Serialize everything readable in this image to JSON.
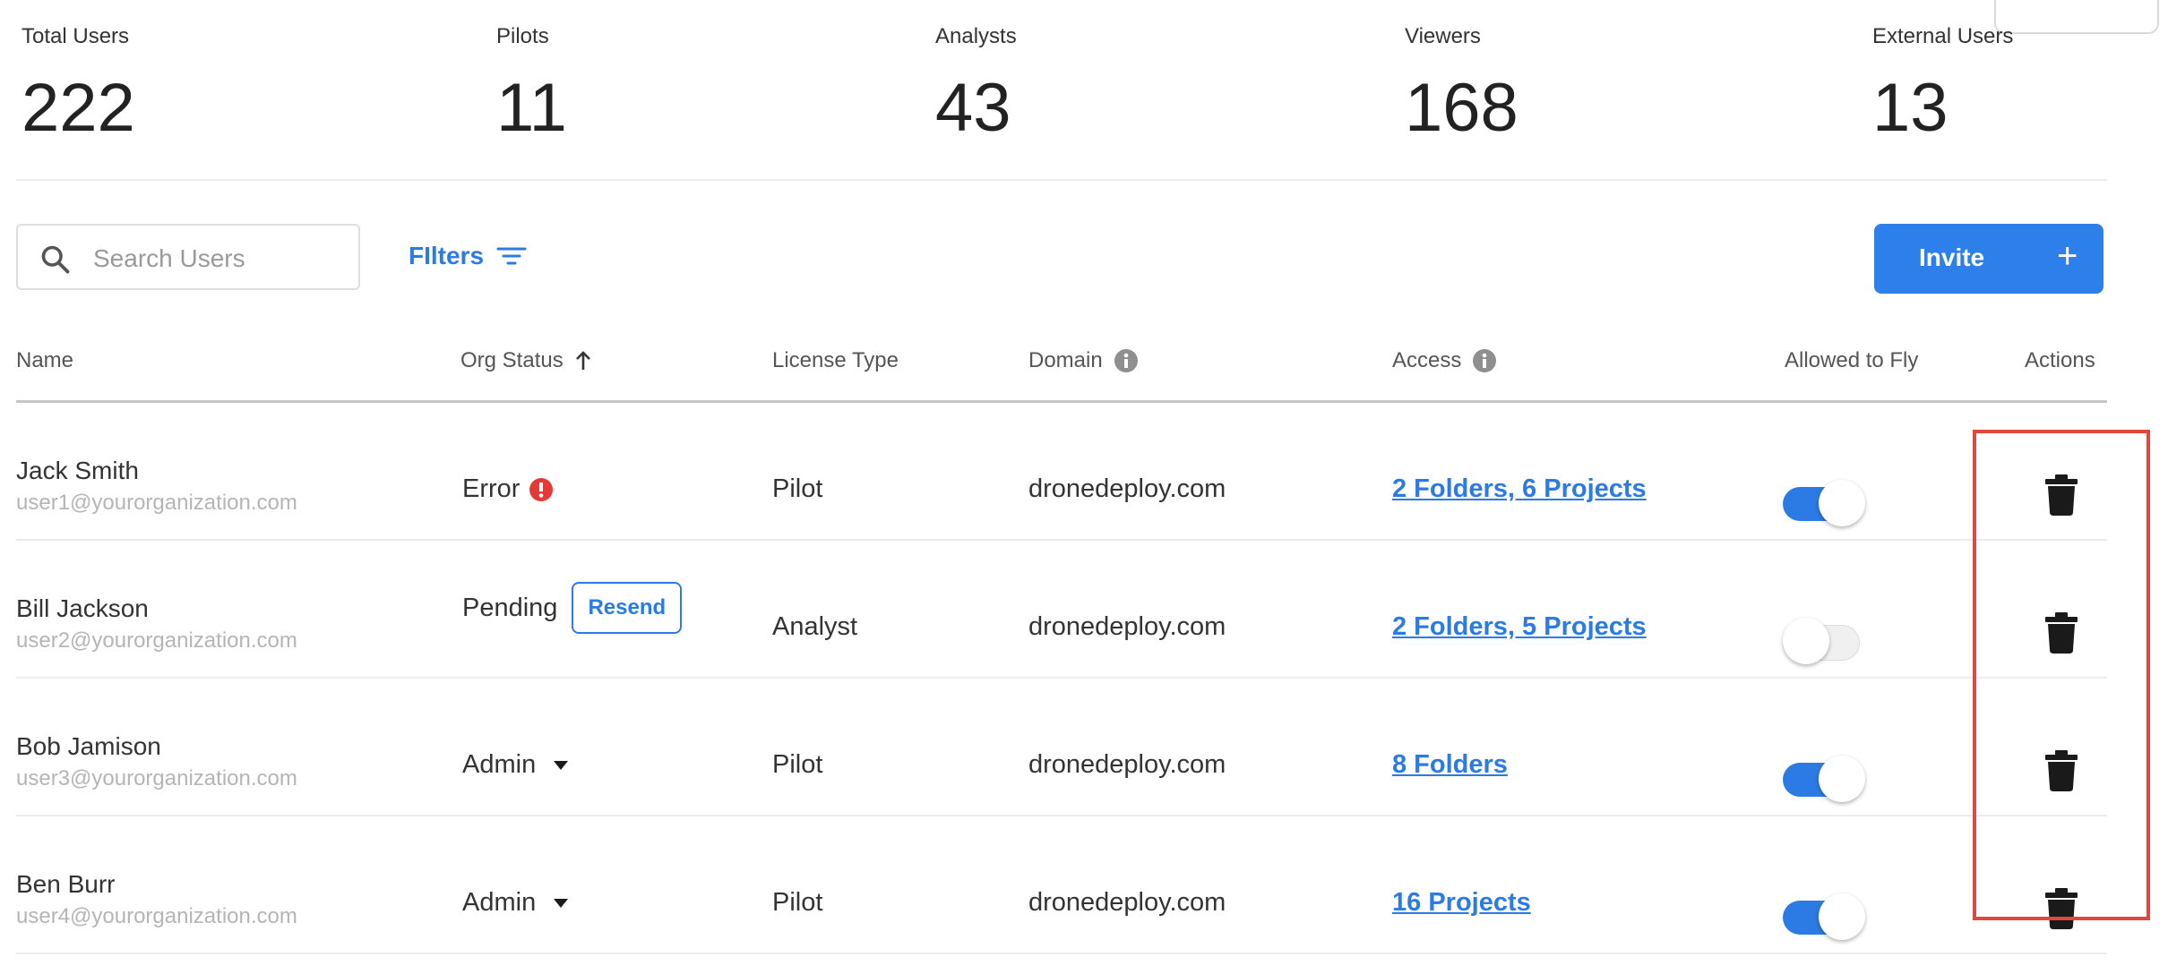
{
  "stats": [
    {
      "label": "Total Users",
      "value": "222"
    },
    {
      "label": "Pilots",
      "value": "11"
    },
    {
      "label": "Analysts",
      "value": "43"
    },
    {
      "label": "Viewers",
      "value": "168"
    },
    {
      "label": "External Users",
      "value": "13"
    }
  ],
  "toolbar": {
    "search_placeholder": "Search Users",
    "filters_label": "FIlters",
    "invite_label": "Invite",
    "invite_plus": "+"
  },
  "table": {
    "headers": {
      "name": "Name",
      "org_status": "Org Status",
      "license_type": "License Type",
      "domain": "Domain",
      "access": "Access",
      "allowed_to_fly": "Allowed to Fly",
      "actions": "Actions"
    },
    "rows": [
      {
        "name": "Jack Smith",
        "email": "user1@yourorganization.com",
        "status": "Error",
        "license": "Pilot",
        "domain": "dronedeploy.com",
        "access": "2 Folders, 6 Projects",
        "allowed_to_fly": true
      },
      {
        "name": "Bill Jackson",
        "email": "user2@yourorganization.com",
        "status": "Pending",
        "action_label": "Resend",
        "license": "Analyst",
        "domain": "dronedeploy.com",
        "access": "2 Folders, 5 Projects",
        "allowed_to_fly": false
      },
      {
        "name": "Bob Jamison",
        "email": "user3@yourorganization.com",
        "status": "Admin",
        "license": "Pilot",
        "domain": "dronedeploy.com",
        "access": "8 Folders",
        "allowed_to_fly": true
      },
      {
        "name": "Ben Burr",
        "email": "user4@yourorganization.com",
        "status": "Admin",
        "license": "Pilot",
        "domain": "dronedeploy.com",
        "access": "16 Projects",
        "allowed_to_fly": true
      }
    ]
  },
  "colors": {
    "accent": "#2c7be5",
    "error": "#e53935",
    "highlight": "#e0483d"
  }
}
